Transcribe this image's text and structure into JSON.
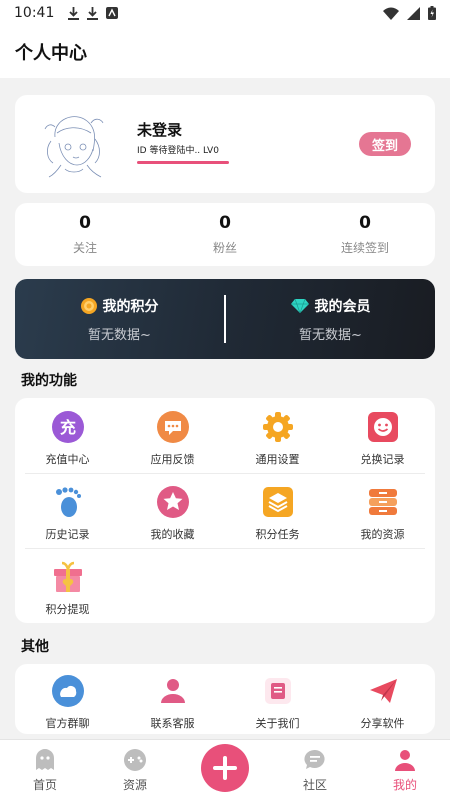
{
  "status_bar": {
    "time": "10:41"
  },
  "header": {
    "title": "个人中心"
  },
  "profile": {
    "name": "未登录",
    "id_line": "ID  等待登陆中..  LV0",
    "sign_button": "签到"
  },
  "stats": [
    {
      "value": "0",
      "label": "关注"
    },
    {
      "value": "0",
      "label": "粉丝"
    },
    {
      "value": "0",
      "label": "连续签到"
    }
  ],
  "vip": {
    "points_title": "我的积分",
    "points_sub": "暂无数据~",
    "member_title": "我的会员",
    "member_sub": "暂无数据~"
  },
  "functions": {
    "title": "我的功能",
    "items": [
      {
        "label": "充值中心",
        "icon": "recharge-icon",
        "glyph": "充",
        "color": "#9b59d6"
      },
      {
        "label": "应用反馈",
        "icon": "feedback-icon",
        "color": "#f08a45"
      },
      {
        "label": "通用设置",
        "icon": "gear-icon",
        "color": "#f5a623"
      },
      {
        "label": "兑换记录",
        "icon": "exchange-icon",
        "color": "#e84a5f"
      },
      {
        "label": "历史记录",
        "icon": "footprint-icon",
        "color": "#4a90d9"
      },
      {
        "label": "我的收藏",
        "icon": "star-icon",
        "color": "#e05a85"
      },
      {
        "label": "积分任务",
        "icon": "layers-icon",
        "color": "#f5a623"
      },
      {
        "label": "我的资源",
        "icon": "resource-icon",
        "color": "#f07a3c"
      },
      {
        "label": "积分提现",
        "icon": "gift-icon",
        "color": "#f06f8f"
      }
    ]
  },
  "others": {
    "title": "其他",
    "items": [
      {
        "label": "官方群聊",
        "icon": "group-chat-icon",
        "color": "#4a90d9"
      },
      {
        "label": "联系客服",
        "icon": "customer-service-icon",
        "color": "#e05a85"
      },
      {
        "label": "关于我们",
        "icon": "about-icon",
        "color": "#e05a85"
      },
      {
        "label": "分享软件",
        "icon": "share-icon",
        "color": "#e84a5f"
      }
    ]
  },
  "tabbar": [
    {
      "label": "首页",
      "icon": "ghost-icon"
    },
    {
      "label": "资源",
      "icon": "gamepad-icon"
    },
    {
      "label": "社区",
      "icon": "chat-icon"
    },
    {
      "label": "我的",
      "icon": "user-icon",
      "active": true
    }
  ],
  "colors": {
    "accent": "#e8507a",
    "sign": "#e57693"
  }
}
